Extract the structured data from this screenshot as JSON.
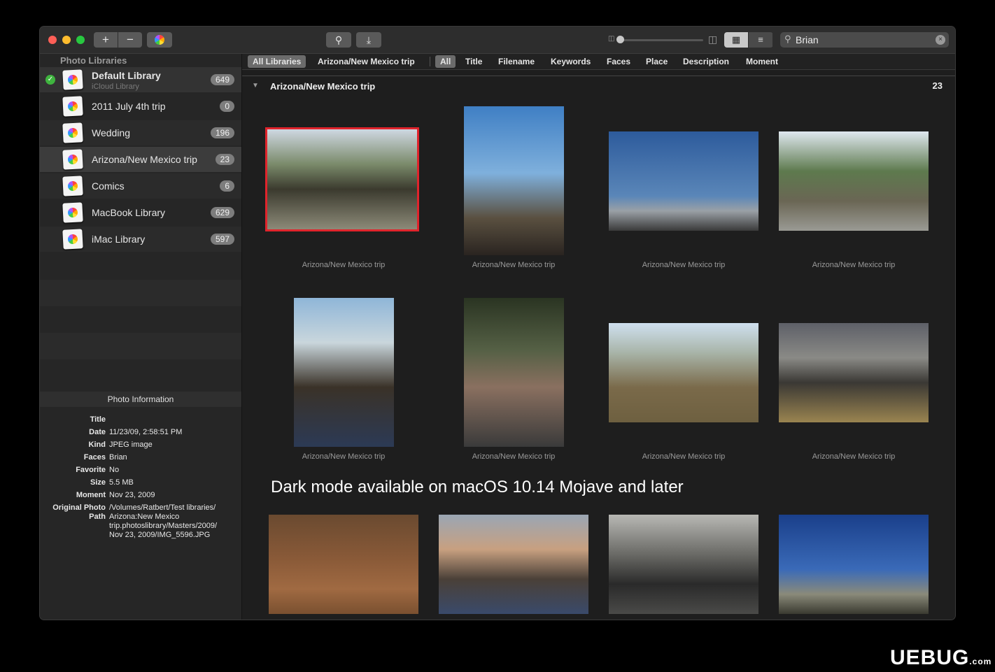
{
  "sidebar": {
    "header": "Photo Libraries",
    "libraries": [
      {
        "name": "Default Library",
        "sub": "iCloud Library",
        "count": "649"
      },
      {
        "name": "2011 July 4th trip",
        "count": "0"
      },
      {
        "name": "Wedding",
        "count": "196"
      },
      {
        "name": "Arizona/New Mexico trip",
        "count": "23"
      },
      {
        "name": "Comics",
        "count": "6"
      },
      {
        "name": "MacBook Library",
        "count": "629"
      },
      {
        "name": "iMac Library",
        "count": "597"
      }
    ],
    "photo_info": {
      "header": "Photo Information",
      "title_label": "Title",
      "title_value": "",
      "date_label": "Date",
      "date_value": "11/23/09, 2:58:51 PM",
      "kind_label": "Kind",
      "kind_value": "JPEG image",
      "faces_label": "Faces",
      "faces_value": "Brian",
      "favorite_label": "Favorite",
      "favorite_value": "No",
      "size_label": "Size",
      "size_value": "5.5 MB",
      "moment_label": "Moment",
      "moment_value": "Nov 23, 2009",
      "path_label_1": "Original Photo",
      "path_label_2": "Path",
      "path_value_1": "/Volumes/Ratbert/Test libraries/",
      "path_value_2": "Arizona:New Mexico",
      "path_value_3": "trip.photoslibrary/Masters/2009/",
      "path_value_4": "Nov 23, 2009/IMG_5596.JPG"
    }
  },
  "toolbar": {
    "plus": "+",
    "minus": "−",
    "search_value": "Brian",
    "clear": "×"
  },
  "filters": {
    "libraries_scope": "All Libraries",
    "current_library": "Arizona/New Mexico trip",
    "fields": [
      "All",
      "Title",
      "Filename",
      "Keywords",
      "Faces",
      "Place",
      "Description",
      "Moment"
    ]
  },
  "group": {
    "title": "Arizona/New Mexico trip",
    "count": "23"
  },
  "photos": {
    "caption": "Arizona/New Mexico trip",
    "captions": [
      "Arizona/New Mexico trip",
      "Arizona/New Mexico trip",
      "Arizona/New Mexico trip",
      "Arizona/New Mexico trip",
      "Arizona/New Mexico trip",
      "Arizona/New Mexico trip",
      "Arizona/New Mexico trip",
      "Arizona/New Mexico trip"
    ]
  },
  "banner": "Dark mode available on macOS 10.14 Mojave and later",
  "watermark": {
    "main": "UEBUG",
    "tld": ".com"
  },
  "colors": {
    "selection": "#e0242c",
    "check": "#3fb43f",
    "count_badge": "#7d7d7d"
  }
}
